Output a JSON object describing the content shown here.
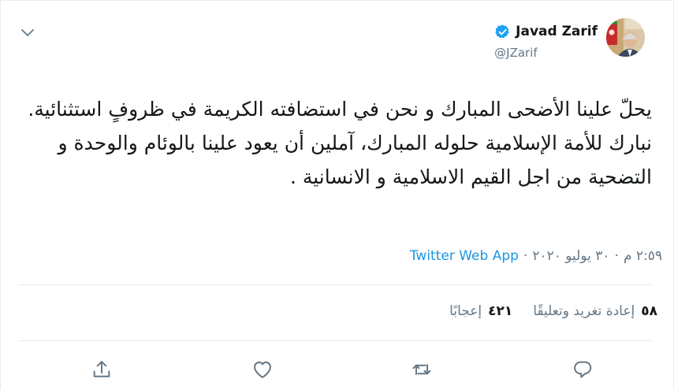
{
  "user": {
    "name": "Javad Zarif",
    "handle": "@JZarif",
    "avatar": "avatar-icon",
    "verified": "verified-badge-icon"
  },
  "tweet": {
    "text": "يحلّ علينا الأضحى المبارك و نحن في استضافته الكريمة في ظروفٍ استثنائية. نبارك للأمة الإسلامية حلوله المبارك، آملين أن يعود علينا بالوئام والوحدة و التضحية من اجل القيم الاسلامية و الانسانية ."
  },
  "meta": {
    "time": "٢:٥٩ م",
    "separator": "·",
    "date": "٣٠ يوليو ٢٠٢٠",
    "separator2": "·",
    "source": "Twitter Web App"
  },
  "stats": {
    "retweets_count": "٥٨",
    "retweets_label": "إعادة تغريد وتعليقًا",
    "likes_count": "٤٢١",
    "likes_label": "إعجابًا"
  },
  "actions": {
    "reply": "reply-icon",
    "retweet": "retweet-icon",
    "like": "heart-icon",
    "share": "share-icon"
  },
  "colors": {
    "link": "#1b95e0",
    "muted": "#657786",
    "text": "#14171a",
    "border": "#e6ecf0"
  }
}
